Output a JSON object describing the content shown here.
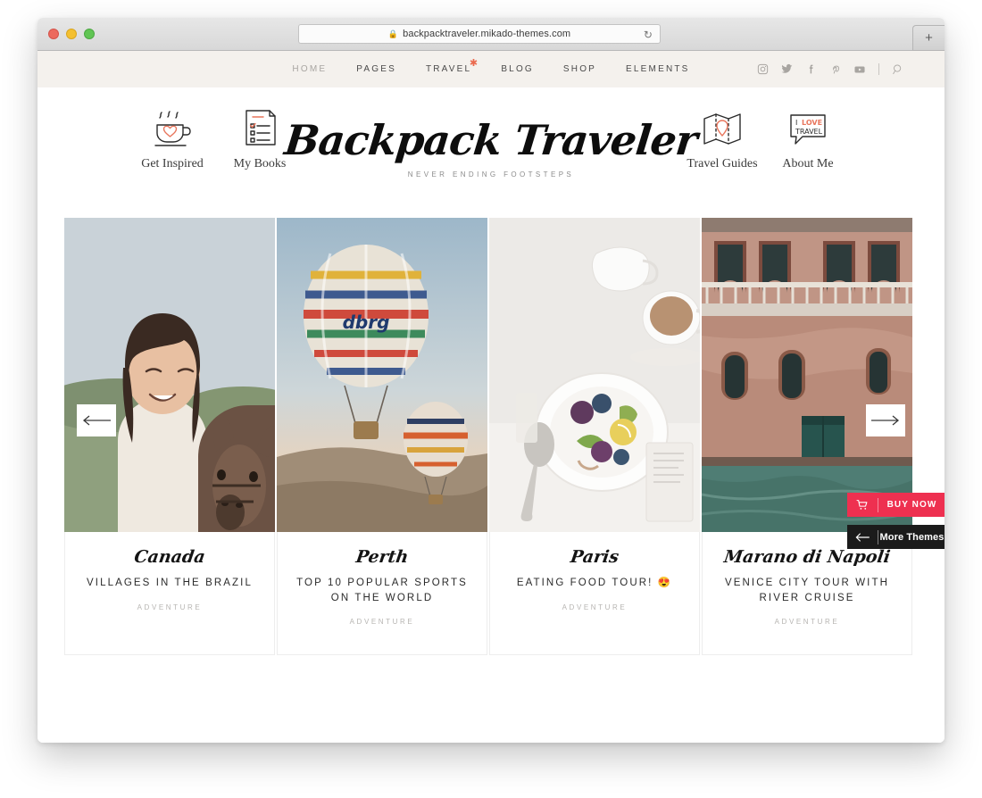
{
  "browser": {
    "url": "backpacktraveler.mikado-themes.com",
    "lock_icon": "lock-icon",
    "reload_icon": "reload-icon",
    "new_tab_label": "+"
  },
  "nav": {
    "items": [
      {
        "label": "HOME",
        "dim": true,
        "star": false
      },
      {
        "label": "PAGES",
        "dim": false,
        "star": false
      },
      {
        "label": "TRAVEL",
        "dim": false,
        "star": true
      },
      {
        "label": "BLOG",
        "dim": false,
        "star": false
      },
      {
        "label": "SHOP",
        "dim": false,
        "star": false
      },
      {
        "label": "ELEMENTS",
        "dim": false,
        "star": false
      }
    ],
    "social": [
      {
        "name": "instagram-icon"
      },
      {
        "name": "twitter-icon"
      },
      {
        "name": "facebook-icon"
      },
      {
        "name": "pinterest-icon"
      },
      {
        "name": "youtube-icon"
      }
    ],
    "search_icon": "search-icon",
    "background": "#f4f1ed",
    "star_color": "#ea6a4e"
  },
  "brand": {
    "name": "Backpack Traveler",
    "tagline": "NEVER ENDING FOOTSTEPS"
  },
  "quick_links": [
    {
      "label": "Get Inspired",
      "icon": "coffee-cup-heart-icon"
    },
    {
      "label": "My Books",
      "icon": "todo-list-icon"
    },
    {
      "label": "Travel Guides",
      "icon": "map-pin-icon"
    },
    {
      "label": "About Me",
      "icon": "speech-bubble-i-love-travel-icon"
    }
  ],
  "slider": {
    "prev_icon": "arrow-left-icon",
    "next_icon": "arrow-right-icon",
    "cards": [
      {
        "place": "Canada",
        "title": "VILLAGES IN THE BRAZIL",
        "category": "ADVENTURE",
        "image": "woman-with-donkey-photo"
      },
      {
        "place": "Perth",
        "title": "TOP 10 POPULAR SPORTS ON THE WORLD",
        "category": "ADVENTURE",
        "image": "hot-air-balloons-photo"
      },
      {
        "place": "Paris",
        "title": "EATING FOOD TOUR! 😍",
        "category": "ADVENTURE",
        "image": "breakfast-fruit-bowl-photo"
      },
      {
        "place": "Marano di Napoli",
        "title": "VENICE CITY TOUR WITH RIVER CRUISE",
        "category": "ADVENTURE",
        "image": "venice-canal-building-photo"
      }
    ]
  },
  "promo": {
    "buy_now": {
      "label": "BUY NOW",
      "icon": "shopping-cart-icon",
      "color": "#ee3050"
    },
    "more_themes": {
      "label": "More Themes",
      "icon": "arrow-left-icon",
      "color": "#1b1b1b"
    }
  }
}
